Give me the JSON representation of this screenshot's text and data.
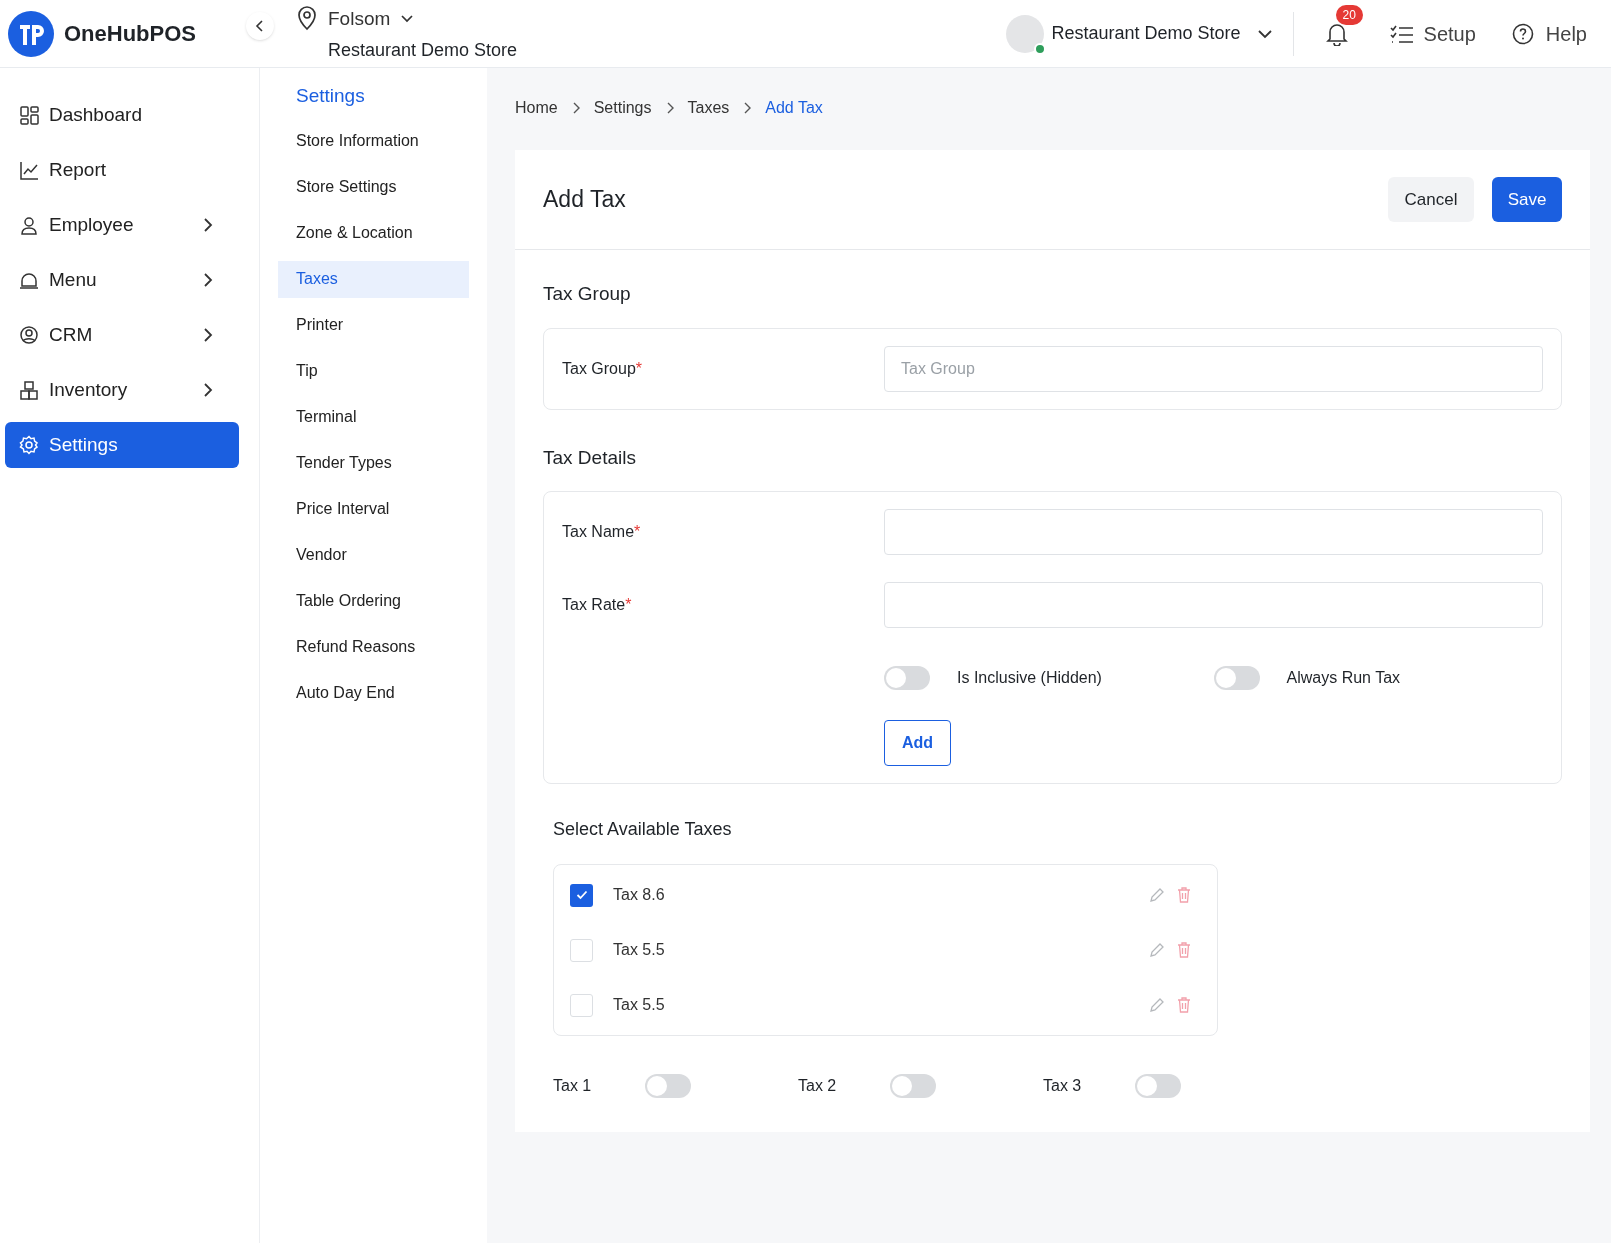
{
  "brand": {
    "name": "OneHubPOS"
  },
  "location": {
    "city": "Folsom",
    "store": "Restaurant Demo Store"
  },
  "header": {
    "store": "Restaurant Demo Store",
    "online": true,
    "notifications": "20",
    "setup": "Setup",
    "help": "Help"
  },
  "sidebar": {
    "items": [
      {
        "label": "Dashboard",
        "has_children": false,
        "selected": false
      },
      {
        "label": "Report",
        "has_children": false,
        "selected": false
      },
      {
        "label": "Employee",
        "has_children": true,
        "selected": false
      },
      {
        "label": "Menu",
        "has_children": true,
        "selected": false
      },
      {
        "label": "CRM",
        "has_children": true,
        "selected": false
      },
      {
        "label": "Inventory",
        "has_children": true,
        "selected": false
      },
      {
        "label": "Settings",
        "has_children": false,
        "selected": true
      }
    ]
  },
  "settings_menu": {
    "title": "Settings",
    "items": [
      {
        "label": "Store Information",
        "selected": false
      },
      {
        "label": "Store Settings",
        "selected": false
      },
      {
        "label": "Zone & Location",
        "selected": false
      },
      {
        "label": "Taxes",
        "selected": true
      },
      {
        "label": "Printer",
        "selected": false
      },
      {
        "label": "Tip",
        "selected": false
      },
      {
        "label": "Terminal",
        "selected": false
      },
      {
        "label": "Tender Types",
        "selected": false
      },
      {
        "label": "Price Interval",
        "selected": false
      },
      {
        "label": "Vendor",
        "selected": false
      },
      {
        "label": "Table Ordering",
        "selected": false
      },
      {
        "label": "Refund Reasons",
        "selected": false
      },
      {
        "label": "Auto Day End",
        "selected": false
      }
    ]
  },
  "breadcrumb": [
    "Home",
    "Settings",
    "Taxes",
    "Add Tax"
  ],
  "form": {
    "title": "Add Tax",
    "required_mark": "*",
    "buttons": {
      "cancel": "Cancel",
      "save": "Save"
    },
    "tax_group": {
      "heading": "Tax Group",
      "label": "Tax Group",
      "required": true,
      "placeholder": "Tax Group"
    },
    "tax_details": {
      "heading": "Tax Details",
      "fields": [
        {
          "label": "Tax Name",
          "required": true
        },
        {
          "label": "Tax Rate",
          "required": true
        }
      ],
      "toggles": [
        {
          "label": "Is Inclusive (Hidden)",
          "on": false
        },
        {
          "label": "Always Run Tax",
          "on": false
        }
      ],
      "add_button": "Add"
    },
    "available_taxes": {
      "heading": "Select Available Taxes",
      "items": [
        {
          "label": "Tax 8.6",
          "checked": true
        },
        {
          "label": "Tax 5.5",
          "checked": false
        },
        {
          "label": "Tax 5.5",
          "checked": false
        }
      ]
    },
    "tax_toggles": [
      {
        "label": "Tax 1",
        "on": false
      },
      {
        "label": "Tax 2",
        "on": false
      },
      {
        "label": "Tax 3",
        "on": false
      }
    ]
  }
}
